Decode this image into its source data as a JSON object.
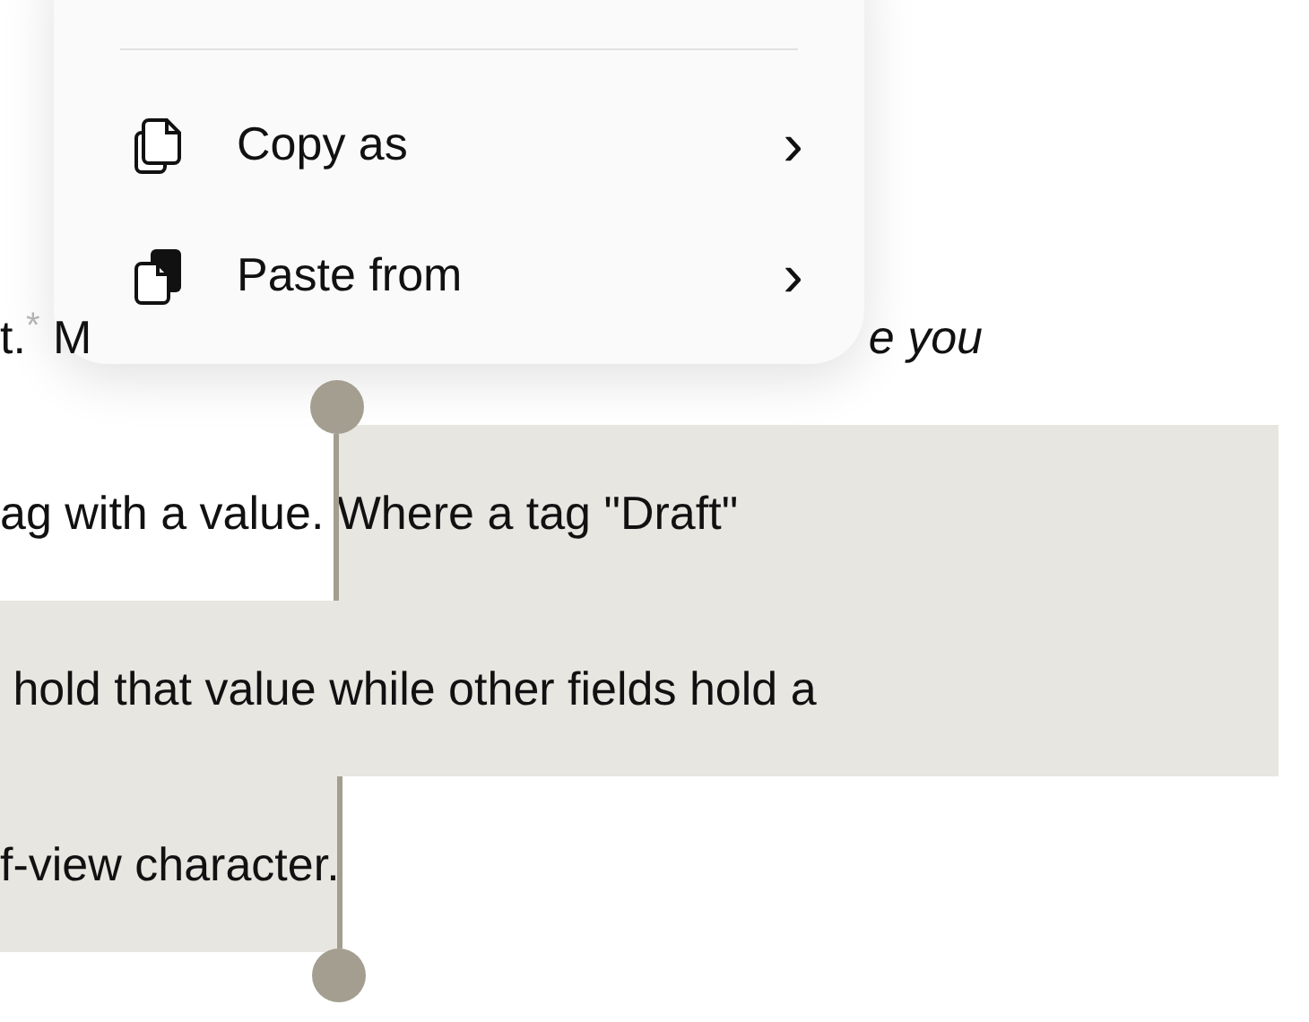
{
  "context_menu": {
    "items": [
      {
        "label": "Copy as",
        "kind": "copy",
        "submenu_chevron": "›"
      },
      {
        "label": "Paste from",
        "kind": "paste",
        "submenu_chevron": "›"
      }
    ]
  },
  "document": {
    "lines": [
      {
        "segments": [
          {
            "text": "t.",
            "kind": "plain",
            "selected": false
          },
          {
            "text": "*",
            "kind": "footnote",
            "selected": false
          },
          {
            "text": " M",
            "kind": "plain",
            "selected": false
          },
          {
            "text": "e you",
            "kind": "italic",
            "selected": false
          }
        ]
      },
      {
        "segments": [
          {
            "text": "ag with a value. ",
            "kind": "plain",
            "selected": false
          },
          {
            "text": "Where a tag \"Draft\"",
            "kind": "plain",
            "selected": true
          }
        ]
      },
      {
        "segments": [
          {
            "text": " hold that value while other fields hold a",
            "kind": "plain",
            "selected": true
          }
        ]
      },
      {
        "segments": [
          {
            "text": "f-view character.",
            "kind": "plain",
            "selected": true
          }
        ]
      }
    ]
  }
}
